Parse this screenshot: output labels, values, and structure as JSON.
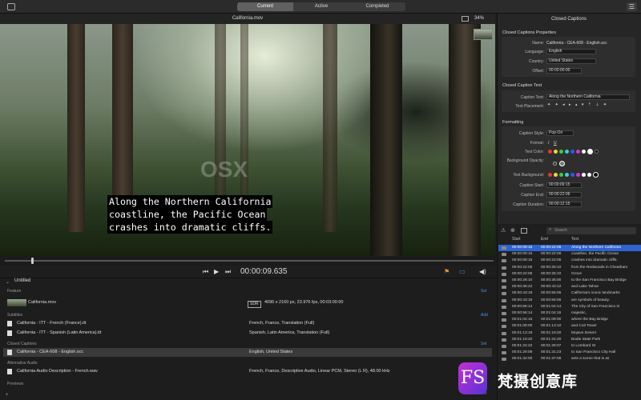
{
  "tabs": [
    "Current",
    "Active",
    "Completed"
  ],
  "active_tab": "Current",
  "viewer": {
    "filename": "California.mov",
    "zoom": "34%",
    "timecode": "00:00:09.635"
  },
  "captions_overlay": [
    "Along the Northern California",
    "coastline, the Pacific Ocean",
    "crashes into dramatic cliffs."
  ],
  "inspector": {
    "title": "Closed Captions",
    "props_title": "Closed Captions Properties",
    "name_label": "Name:",
    "name": "California - CEA-608 - English.scc",
    "language_label": "Language:",
    "language": "English",
    "country_label": "Country:",
    "country": "United States",
    "offset_label": "Offset:",
    "offset": "00:00:00:00",
    "text_title": "Closed Caption Text",
    "caption_text_label": "Caption Text:",
    "caption_text": "Along the Northern California",
    "placement_label": "Text Placement:",
    "formatting_title": "Formatting",
    "style_label": "Caption Style:",
    "style": "Pop-On",
    "format_label": "Format:",
    "format_i": "I",
    "format_u": "U",
    "text_color_label": "Text Color:",
    "bg_opacity_label": "Background Opacity:",
    "text_bg_label": "Text Background:",
    "start_label": "Caption Start:",
    "start": "00:00:09:15",
    "end_label": "Caption End:",
    "end": "00:00:22:06",
    "duration_label": "Caption Duration:",
    "duration": "00:00:12:15"
  },
  "caption_list": {
    "search_placeholder": "Search",
    "headers": [
      "Start",
      "End",
      "Text"
    ],
    "rows": [
      [
        "00:00:09:15",
        "00:00:22:06",
        "Along the Northern California"
      ],
      [
        "00:00:09:15",
        "00:00:22:06",
        "coastline, the Pacific Ocean"
      ],
      [
        "00:00:09:15",
        "00:00:22:06",
        "crashes into dramatic cliffs."
      ],
      [
        "00:00:22:06",
        "00:00:26:10",
        "from the Redwoods in Cheatham"
      ],
      [
        "00:00:22:06",
        "00:00:26:10",
        "Grove"
      ],
      [
        "00:00:26:10",
        "00:00:36:00",
        "to the San Francisco Bay Bridge"
      ],
      [
        "00:00:36:22",
        "00:00:43:12",
        "and Lake Tahoe"
      ],
      [
        "00:00:43:19",
        "00:00:56:06",
        "California's iconic landmarks"
      ],
      [
        "00:00:43:19",
        "00:00:56:06",
        "are symbols of beauty."
      ],
      [
        "00:00:56:14",
        "00:01:04:14",
        "The City of San Francisco is"
      ],
      [
        "00:00:56:14",
        "00:01:04:15",
        "majestic,"
      ],
      [
        "00:01:04:15",
        "00:01:09:00",
        "where the Bay Bridge"
      ],
      [
        "00:01:09:00",
        "00:01:13:10",
        "and Coit Tower"
      ],
      [
        "00:01:13:19",
        "00:01:19:20",
        "Mojave Desert"
      ],
      [
        "00:01:19:20",
        "00:01:24:20",
        "Bodie State Park"
      ],
      [
        "00:01:24:22",
        "00:01:29:07",
        "to Lombard St"
      ],
      [
        "00:01:29:08",
        "00:01:31:23",
        "to San Francisco City Hall"
      ],
      [
        "00:01:32:00",
        "00:01:37:08",
        "sets a scene that is as"
      ]
    ]
  },
  "bottom": {
    "title": "Untitled",
    "feature_label": "Feature",
    "subtitles_label": "Subtitles",
    "cc_label": "Closed Captions",
    "alt_audio_label": "Alternative Audio",
    "previews_label": "Previews",
    "set_label": "Set",
    "add_label": "Add",
    "feature": {
      "name": "California.mov",
      "badge": "SDR",
      "props": "4096 x 2160 px, 23.976 fps, 00:03:00:00"
    },
    "subtitles": [
      {
        "name": "California - ITT - French (France).itt",
        "props": "French, France, Translation (Full)"
      },
      {
        "name": "California - ITT - Spanish (Latin America).itt",
        "props": "Spanish, Latin America, Translation (Full)"
      }
    ],
    "cc": {
      "name": "California - CEA-608 - English.scc",
      "props": "English, United States"
    },
    "audio": {
      "name": "California Audio Description - French.wav",
      "props": "French, France, Descriptive Audio, Linear PCM, Stereo (L R), 48.00 kHz"
    }
  },
  "watermark": {
    "logo": "FS",
    "text": "梵摄创意库",
    "overlay": "OSX"
  }
}
